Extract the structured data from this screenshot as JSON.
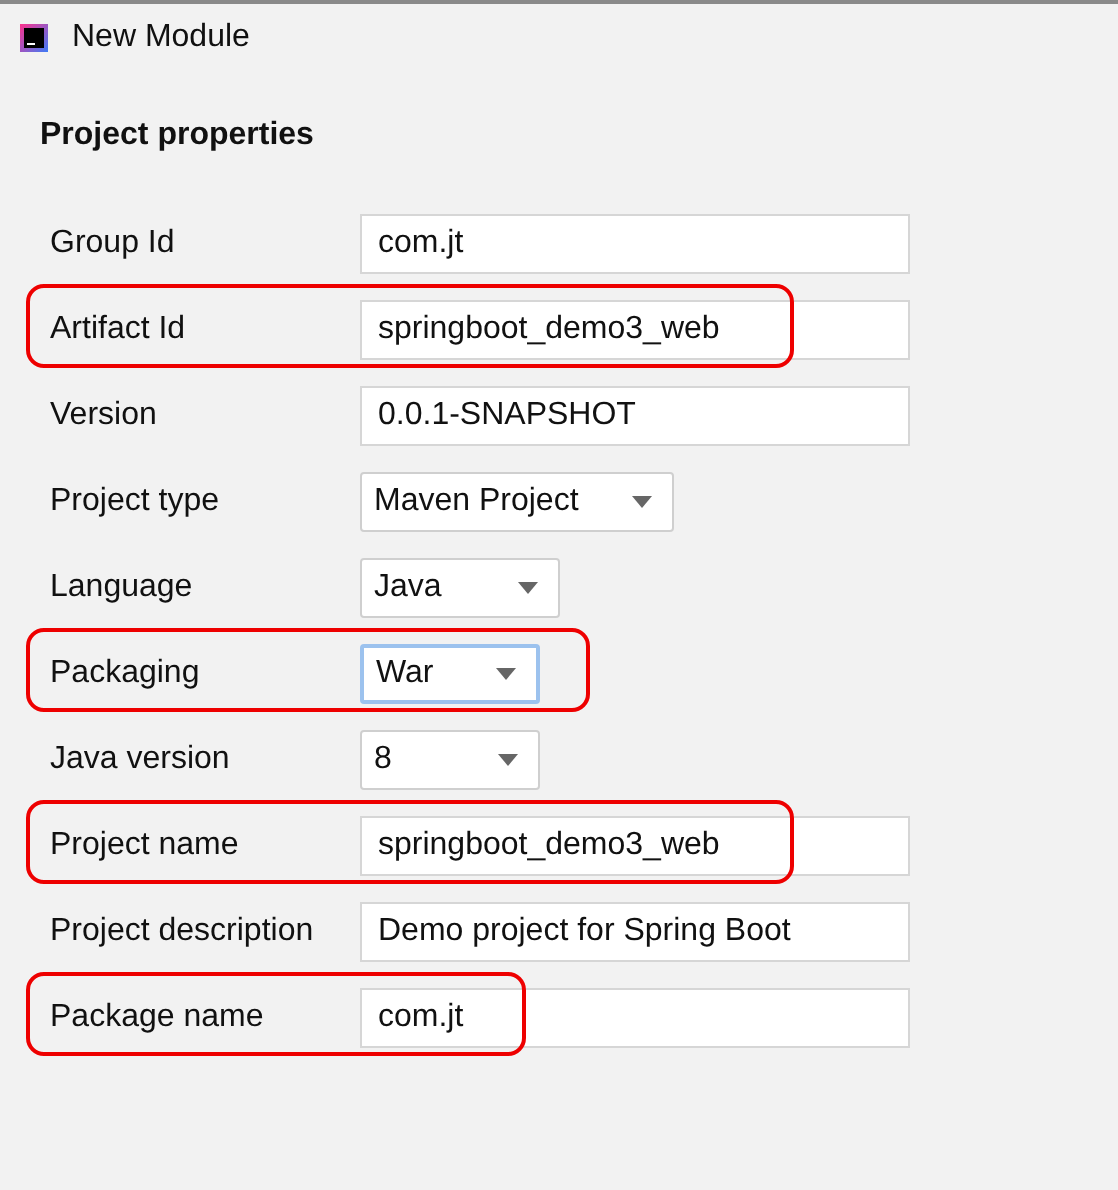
{
  "window": {
    "title": "New Module"
  },
  "section_title": "Project properties",
  "fields": [
    {
      "label": "Group Id",
      "kind": "text",
      "value": "com.jt",
      "highlighted": false
    },
    {
      "label": "Artifact Id",
      "kind": "text",
      "value": "springboot_demo3_web",
      "highlighted": true
    },
    {
      "label": "Version",
      "kind": "text",
      "value": "0.0.1-SNAPSHOT",
      "highlighted": false
    },
    {
      "label": "Project type",
      "kind": "dropdown",
      "value": "Maven Project",
      "focused": false,
      "highlighted": false
    },
    {
      "label": "Language",
      "kind": "dropdown",
      "value": "Java",
      "focused": false,
      "highlighted": false
    },
    {
      "label": "Packaging",
      "kind": "dropdown",
      "value": "War",
      "focused": true,
      "highlighted": true
    },
    {
      "label": "Java version",
      "kind": "dropdown",
      "value": "8",
      "focused": false,
      "highlighted": false
    },
    {
      "label": "Project name",
      "kind": "text",
      "value": "springboot_demo3_web",
      "highlighted": true
    },
    {
      "label": "Project description",
      "kind": "text",
      "value": "Demo project for Spring Boot",
      "highlighted": false
    },
    {
      "label": "Package name",
      "kind": "text",
      "value": "com.jt",
      "highlighted": true
    }
  ]
}
